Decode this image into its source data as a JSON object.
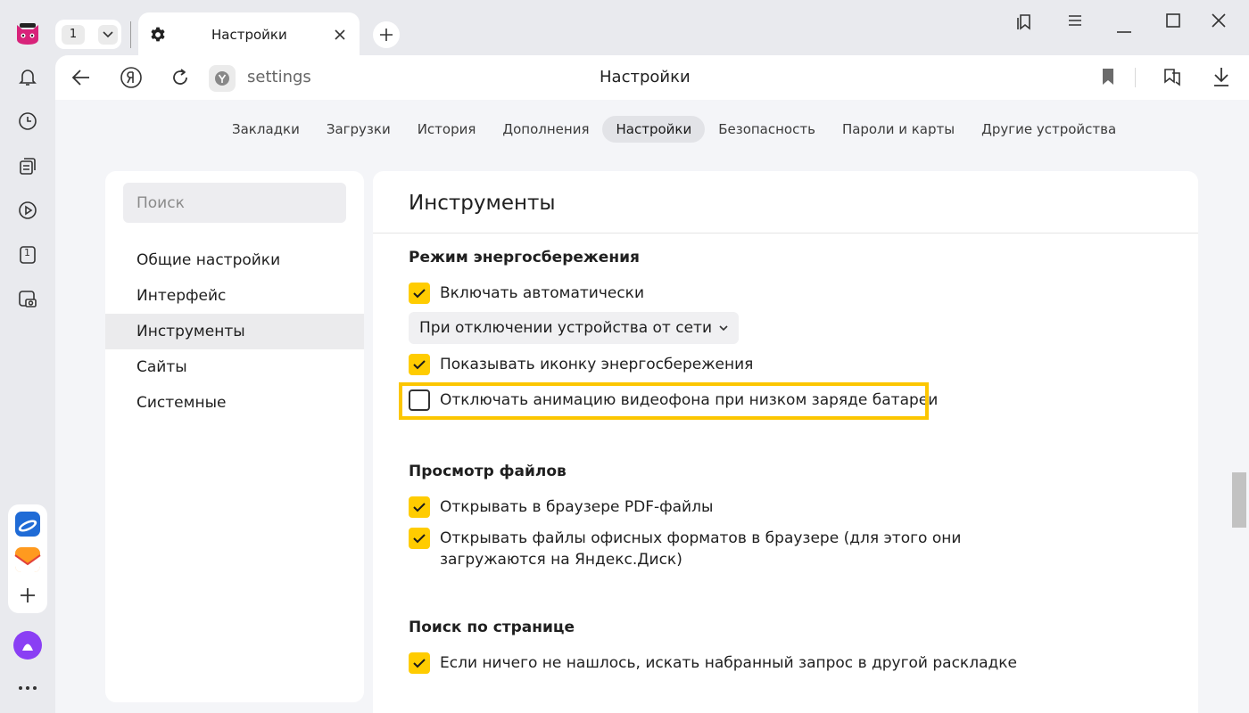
{
  "colors": {
    "accent": "#ffcc00",
    "highlight": "#fcc600",
    "alice": "#8a3ff4"
  },
  "tabs": {
    "count": "1",
    "active_title": "Настройки"
  },
  "omnibox": {
    "url": "settings",
    "page_title": "Настройки"
  },
  "nav": {
    "items": [
      {
        "label": "Закладки"
      },
      {
        "label": "Загрузки"
      },
      {
        "label": "История"
      },
      {
        "label": "Дополнения"
      },
      {
        "label": "Настройки"
      },
      {
        "label": "Безопасность"
      },
      {
        "label": "Пароли и карты"
      },
      {
        "label": "Другие устройства"
      }
    ],
    "active": "Настройки"
  },
  "sidebar": {
    "search_placeholder": "Поиск",
    "items": [
      {
        "label": "Общие настройки"
      },
      {
        "label": "Интерфейс"
      },
      {
        "label": "Инструменты"
      },
      {
        "label": "Сайты"
      },
      {
        "label": "Системные"
      }
    ],
    "active": "Инструменты",
    "rail_tab_counter": "1"
  },
  "main": {
    "title": "Инструменты",
    "sections": [
      {
        "title": "Режим энергосбережения",
        "options": [
          {
            "label": "Включать автоматически",
            "checked": true
          },
          {
            "label": "Показывать иконку энергосбережения",
            "checked": true
          },
          {
            "label": "Отключать анимацию видеофона при низком заряде батареи",
            "checked": false
          }
        ],
        "dropdown_value": "При отключении устройства от сети"
      },
      {
        "title": "Просмотр файлов",
        "options": [
          {
            "label": "Открывать в браузере PDF-файлы",
            "checked": true
          },
          {
            "label": "Открывать файлы офисных форматов в браузере (для этого они загружаются на Яндекс.Диск)",
            "checked": true
          }
        ]
      },
      {
        "title": "Поиск по странице",
        "options": [
          {
            "label": "Если ничего не нашлось, искать набранный запрос в другой раскладке",
            "checked": true
          }
        ]
      }
    ]
  },
  "icons": [
    "cat-avatar-icon",
    "bell-icon",
    "clock-icon",
    "collections-icon",
    "play-icon",
    "tab-counter-icon",
    "screenshot-icon",
    "disk-icon",
    "mail-icon",
    "plus-icon",
    "alice-icon",
    "more-icon",
    "gear-icon",
    "close-icon",
    "back-icon",
    "yandex-icon",
    "reload-icon",
    "site-icon",
    "bookmark-icon",
    "bookmarks-panel-icon",
    "menu-icon",
    "minimize-icon",
    "maximize-icon",
    "close-window-icon",
    "protect-icon",
    "download-icon",
    "chevron-down-icon",
    "checkmark-icon"
  ]
}
